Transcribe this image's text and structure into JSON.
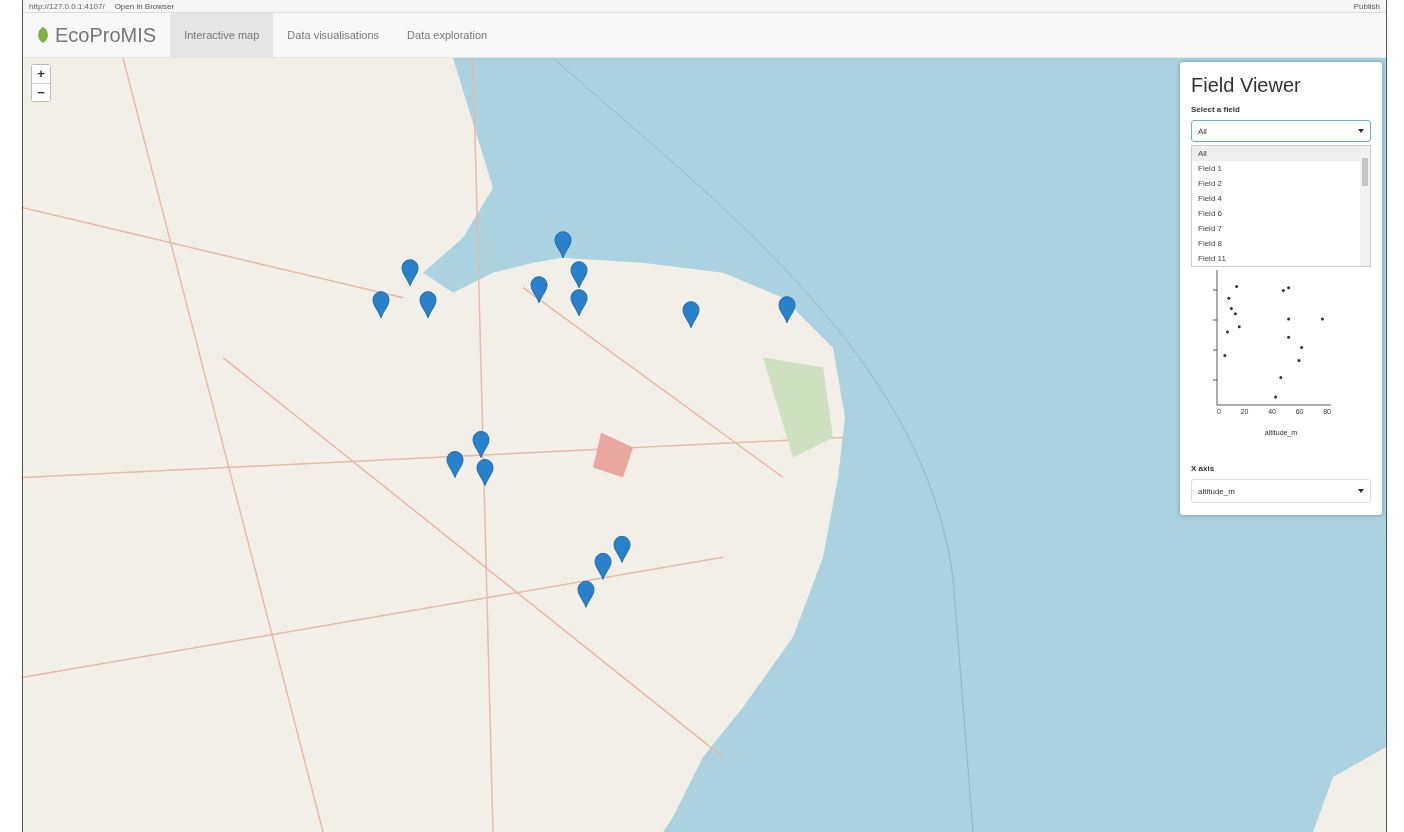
{
  "browser_bar": {
    "address": "http://127.0.0.1:4107/",
    "open_button": "Open in Browser",
    "publish_button": "Publish"
  },
  "navbar": {
    "brand": "EcoProMIS",
    "tabs": [
      {
        "label": "Interactive map",
        "selected": true
      },
      {
        "label": "Data visualisations",
        "selected": false
      },
      {
        "label": "Data exploration",
        "selected": false
      }
    ]
  },
  "map": {
    "zoom_in": "+",
    "zoom_out": "−"
  },
  "field_viewer": {
    "title": "Field Viewer",
    "select_label": "Select a field",
    "select_value": "All",
    "options": [
      {
        "label": "All",
        "selected": true
      },
      {
        "label": "Field 1",
        "selected": false
      },
      {
        "label": "Field 2",
        "selected": false
      },
      {
        "label": "Field 4",
        "selected": false
      },
      {
        "label": "Field 6",
        "selected": false
      },
      {
        "label": "Field 7",
        "selected": false
      },
      {
        "label": "Field 8",
        "selected": false
      },
      {
        "label": "Field 11",
        "selected": false
      }
    ],
    "plot": {
      "x_label": "altitude_m",
      "x_ticks": [
        "0",
        "20",
        "40",
        "60",
        "80"
      ]
    },
    "x_axis_label": "X axis",
    "x_axis_value": "altitude_m"
  }
}
